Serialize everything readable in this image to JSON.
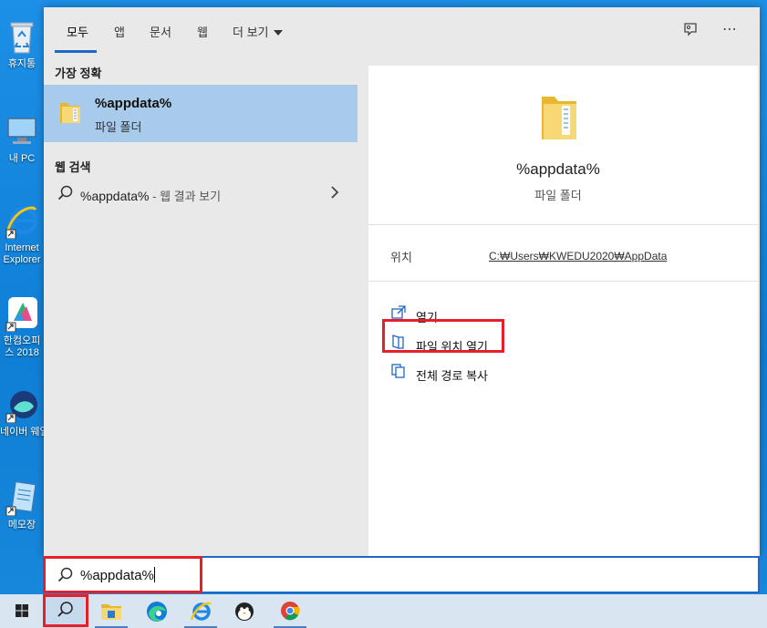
{
  "desktop": {
    "icons": [
      {
        "name": "recycle-bin",
        "label": "휴지통"
      },
      {
        "name": "my-pc",
        "label": "내 PC"
      },
      {
        "name": "internet-explorer",
        "label": "Internet Explorer"
      },
      {
        "name": "hancom-office",
        "label": "한컴오피스 2018"
      },
      {
        "name": "naver-whale",
        "label": "네이버 웨일"
      },
      {
        "name": "notepad",
        "label": "메모장"
      }
    ]
  },
  "tabs": [
    {
      "label": "모두",
      "active": true
    },
    {
      "label": "앱"
    },
    {
      "label": "문서"
    },
    {
      "label": "웹"
    },
    {
      "label": "더 보기"
    }
  ],
  "top_icons": {
    "feedback": "feedback-icon",
    "more": "⋯"
  },
  "left": {
    "best_match_title": "가장 정확",
    "best": {
      "name": "%appdata%",
      "sub": "파일 폴더"
    },
    "web_title": "웹 검색",
    "web": {
      "query": "%appdata%",
      "suffix": " - 웹 결과 보기"
    }
  },
  "right": {
    "title": "%appdata%",
    "sub": "파일 폴더",
    "location_label": "위치",
    "location_path": "C:₩Users₩KWEDU2020₩AppData",
    "actions": {
      "open": "열기",
      "open_location": "파일 위치 열기",
      "copy_path": "전체 경로 복사"
    }
  },
  "search": {
    "value": "%appdata%"
  },
  "colors": {
    "accent": "#1f68c6",
    "highlight": "#a9cbeb",
    "red": "#e5202a",
    "taskbar": "#d9e6f2"
  }
}
